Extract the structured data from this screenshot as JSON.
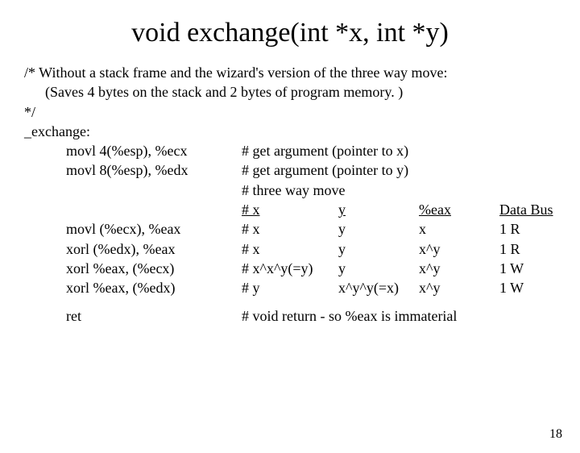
{
  "title": "void exchange(int *x, int *y)",
  "comment1": "/* Without a stack frame and the wizard's version of the three way move:",
  "comment2": "(Saves 4 bytes on the stack and 2 bytes of program memory. )",
  "comment3": "*/",
  "label": "_exchange:",
  "asm": {
    "l1": "movl 4(%esp), %ecx",
    "l2": "movl 8(%esp), %edx",
    "l3": "movl (%ecx), %eax",
    "l4": "xorl (%edx), %eax",
    "l5": "xorl %eax, (%ecx)",
    "l6": "xorl %eax, (%edx)",
    "ret": "ret"
  },
  "c": {
    "l1": "# get argument (pointer to x)",
    "l2": "# get argument (pointer to y)",
    "l3": "# three way move",
    "hdr_x": "# x",
    "hdr_y": "y",
    "hdr_eax": "%eax",
    "hdr_bus": "Data Bus",
    "r1a": "# x",
    "r1b": "y",
    "r1c": "x",
    "r1d": "1 R",
    "r2a": "# x",
    "r2b": "y",
    "r2c": "x^y",
    "r2d": "1 R",
    "r3a": "# x^x^y(=y)",
    "r3b": "y",
    "r3c": "x^y",
    "r3d": "1 W",
    "r4a": "# y",
    "r4b": "x^y^y(=x)",
    "r4c": "x^y",
    "r4d": "1 W",
    "retc": "# void return - so %eax is immaterial"
  },
  "page": "18"
}
